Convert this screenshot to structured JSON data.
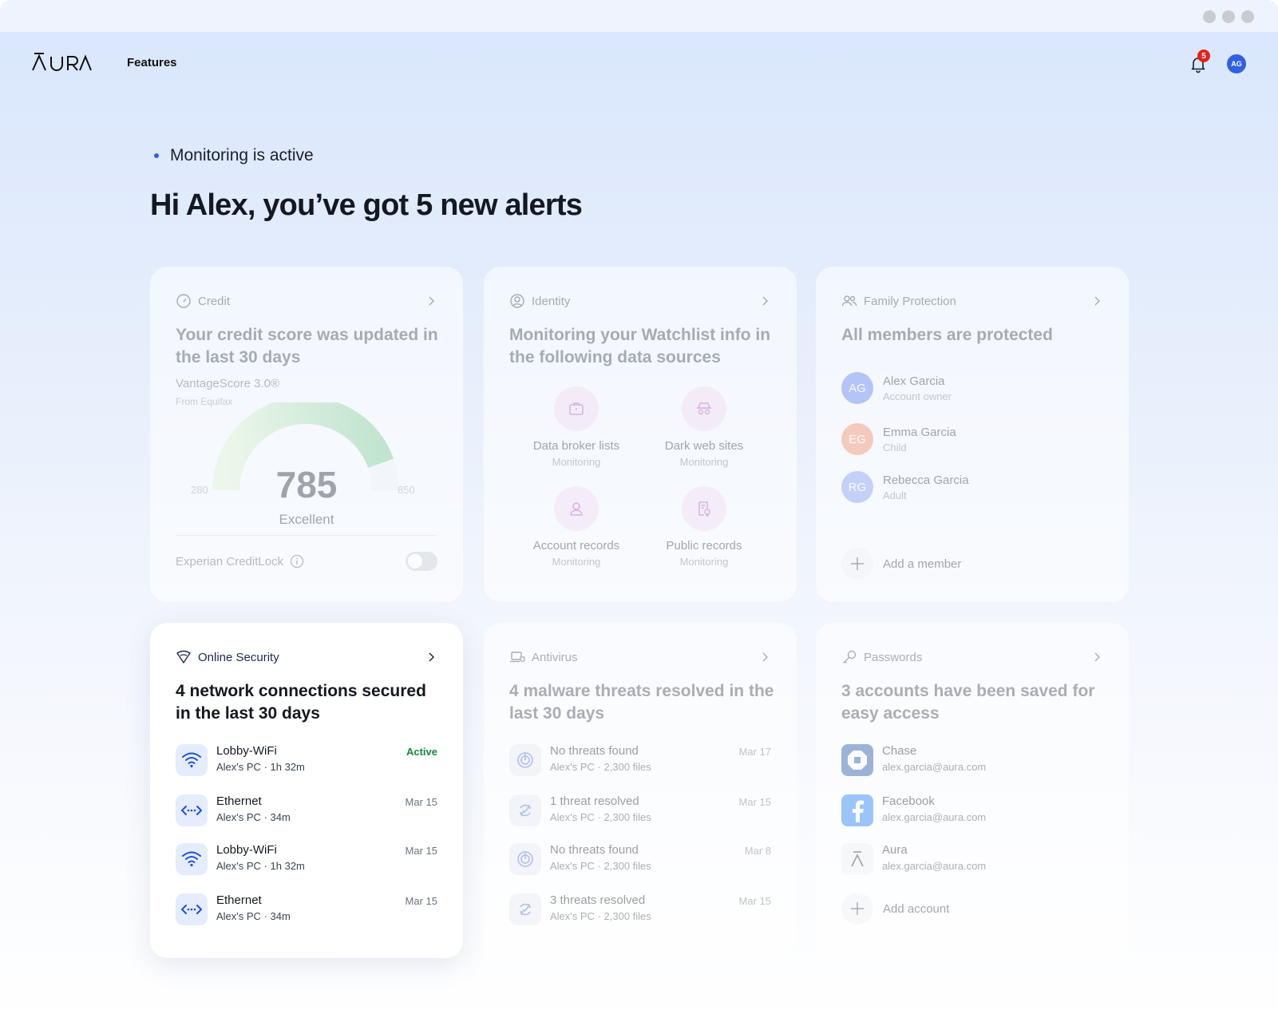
{
  "nav": {
    "features_label": "Features",
    "notification_count": "5",
    "user_initials": "AG"
  },
  "hero": {
    "status_text": "Monitoring is active",
    "headline": "Hi Alex, you’ve got 5 new alerts"
  },
  "credit": {
    "label": "Credit",
    "title": "Your credit score was updated in the last 30 days",
    "score_model": "VantageScore 3.0®",
    "source": "From Equifax",
    "score": "785",
    "rating": "Excellent",
    "range_min": "280",
    "range_max": "850",
    "score_fraction": 0.89,
    "lock_label": "Experian CreditLock"
  },
  "identity": {
    "label": "Identity",
    "title": "Monitoring your Watchlist info in the following data sources",
    "sources": [
      {
        "name": "Data broker lists",
        "status": "Monitoring"
      },
      {
        "name": "Dark web sites",
        "status": "Monitoring"
      },
      {
        "name": "Account records",
        "status": "Monitoring"
      },
      {
        "name": "Public records",
        "status": "Monitoring"
      }
    ]
  },
  "family": {
    "label": "Family Protection",
    "title": "All members are protected",
    "members": [
      {
        "initials": "AG",
        "name": "Alex Garcia",
        "role": "Account owner",
        "color": "#5b7cf0"
      },
      {
        "initials": "EG",
        "name": "Emma Garcia",
        "role": "Child",
        "color": "#f08a64"
      },
      {
        "initials": "RG",
        "name": "Rebecca Garcia",
        "role": "Adult",
        "color": "#7e9af0"
      }
    ],
    "add_label": "Add a member"
  },
  "online_security": {
    "label": "Online Security",
    "title": "4 network connections secured in the last 30 days",
    "rows": [
      {
        "name": "Lobby-WiFi",
        "device": "Alex's PC",
        "duration": "1h 32m",
        "status": "Active",
        "icon": "wifi-icon"
      },
      {
        "name": "Ethernet",
        "device": "Alex's PC",
        "duration": "34m",
        "status": "Mar 15",
        "icon": "ethernet-icon"
      },
      {
        "name": "Lobby-WiFi",
        "device": "Alex's PC",
        "duration": "1h 32m",
        "status": "Mar 15",
        "icon": "wifi-icon"
      },
      {
        "name": "Ethernet",
        "device": "Alex's PC",
        "duration": "34m",
        "status": "Mar 15",
        "icon": "ethernet-icon"
      }
    ]
  },
  "antivirus": {
    "label": "Antivirus",
    "title": "4 malware threats resolved in the last 30 days",
    "rows": [
      {
        "name": "No threats found",
        "device": "Alex's PC",
        "files": "2,300 files",
        "date": "Mar 17"
      },
      {
        "name": "1 threat resolved",
        "device": "Alex's PC",
        "files": "2,300 files",
        "date": "Mar 15"
      },
      {
        "name": "No threats found",
        "device": "Alex's PC",
        "files": "2,300 files",
        "date": "Mar 8"
      },
      {
        "name": "3 threats resolved",
        "device": "Alex's PC",
        "files": "2,300 files",
        "date": "Mar 15"
      }
    ]
  },
  "passwords": {
    "label": "Passwords",
    "title": "3 accounts have been saved for easy access",
    "accounts": [
      {
        "name": "Chase",
        "email": "alex.garcia@aura.com",
        "color": "#1a4fa3"
      },
      {
        "name": "Facebook",
        "email": "alex.garcia@aura.com",
        "color": "#1877f2"
      },
      {
        "name": "Aura",
        "email": "alex.garcia@aura.com",
        "color": "#eef0f4"
      }
    ],
    "add_label": "Add account"
  },
  "colors": {
    "accent": "#2f62e0",
    "success": "#128a3a",
    "badge": "#e2241b",
    "gauge": "#8fd19e"
  }
}
